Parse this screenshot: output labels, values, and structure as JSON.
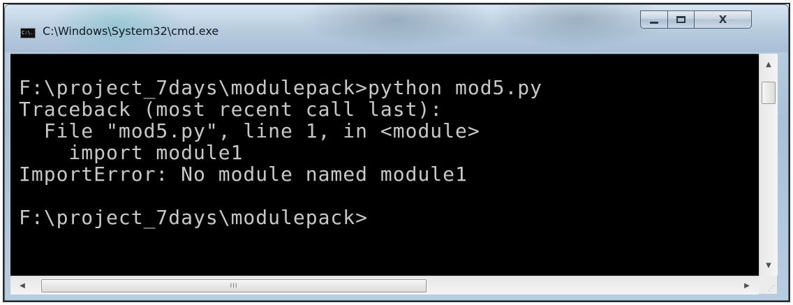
{
  "window": {
    "title": "C:\\Windows\\System32\\cmd.exe",
    "app_icon_text": "C:\\."
  },
  "title_buttons": {
    "minimize_glyph": "",
    "maximize_glyph": "",
    "close_glyph": "X"
  },
  "console": {
    "background_color": "#000000",
    "text_color": "#c8c8c8",
    "lines": [
      "F:\\project_7days\\modulepack>python mod5.py",
      "Traceback (most recent call last):",
      "  File \"mod5.py\", line 1, in <module>",
      "    import module1",
      "ImportError: No module named module1",
      "",
      "F:\\project_7days\\modulepack>"
    ]
  },
  "scrollbars": {
    "up_arrow": "▲",
    "down_arrow": "▼",
    "left_arrow": "◀",
    "right_arrow": "▶",
    "h_thumb_grip": "III",
    "size_grip": "⋰"
  }
}
